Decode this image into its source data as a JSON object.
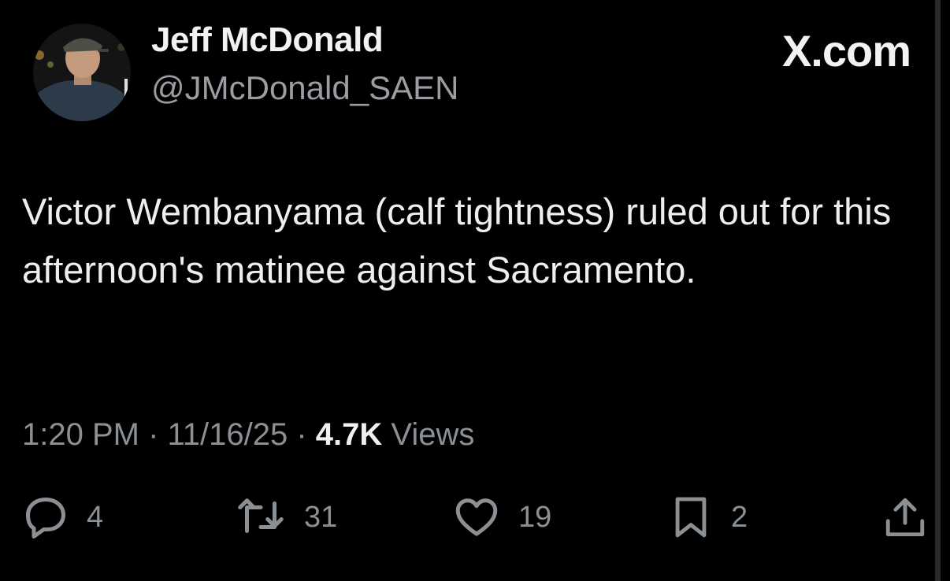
{
  "author": {
    "display_name": "Jeff McDonald",
    "handle": "@JMcDonald_SAEN"
  },
  "brand": "X.com",
  "tweet": {
    "text": "Victor Wembanyama (calf tightness) ruled out for this afternoon's matinee against Sacramento."
  },
  "meta": {
    "time": "1:20 PM",
    "separator": " · ",
    "date": "11/16/25",
    "views_count": "4.7K",
    "views_label": " Views"
  },
  "actions": {
    "replies": "4",
    "reposts": "31",
    "likes": "19",
    "bookmarks": "2"
  },
  "icons": {
    "reply": "reply-icon",
    "repost": "repost-icon",
    "like": "like-icon",
    "bookmark": "bookmark-icon",
    "share": "share-icon"
  },
  "colors": {
    "background": "#000000",
    "primary_text": "#e7e9ea",
    "secondary_text": "#8b9095"
  }
}
